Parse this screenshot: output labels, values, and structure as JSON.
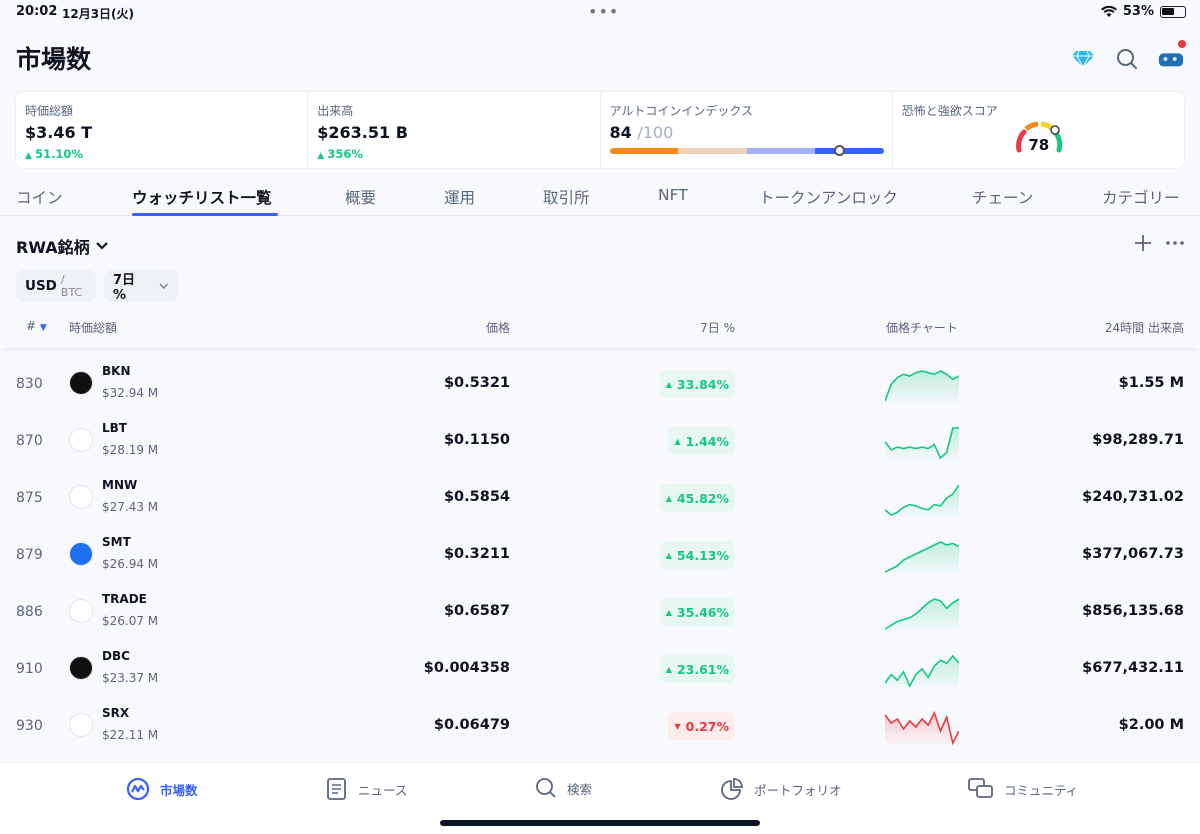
{
  "status_bar": {
    "time": "20:02",
    "date": "12月3日(火)",
    "battery": "53%"
  },
  "header": {
    "title": "市場数"
  },
  "stats": {
    "market_cap": {
      "label": "時価総額",
      "value": "$3.46 T",
      "change": "51.10%"
    },
    "volume": {
      "label": "出来高",
      "value": "$263.51 B",
      "change": "356%"
    },
    "altcoin_index": {
      "label": "アルトコインインデックス",
      "value": "84",
      "max": "/100",
      "level": 0.84
    },
    "fear_greed": {
      "label": "恐怖と強欲スコア",
      "value": "78"
    }
  },
  "tabs": [
    "コイン",
    "ウォッチリスト一覧",
    "概要",
    "運用",
    "取引所",
    "NFT",
    "トークンアンロック",
    "チェーン",
    "カテゴリー"
  ],
  "watchlist": {
    "name": "RWA銘柄",
    "currency_primary": "USD",
    "currency_secondary": "/ BTC",
    "period": "7日 %"
  },
  "table": {
    "headers": {
      "rank": "#",
      "market_cap": "時価総額",
      "price": "価格",
      "change": "7日 %",
      "chart": "価格チャート",
      "volume": "24時間 出来高"
    },
    "rows": [
      {
        "rank": "830",
        "symbol": "BKN",
        "mcap": "$32.94 M",
        "price": "$0.5321",
        "change": "33.84%",
        "trend": "up",
        "volume": "$1.55 M",
        "icon_color": "#111111",
        "spark": [
          12,
          22,
          26,
          28,
          27,
          29,
          30,
          29,
          28,
          30,
          28,
          25,
          27
        ]
      },
      {
        "rank": "870",
        "symbol": "LBT",
        "mcap": "$28.19 M",
        "price": "$0.1150",
        "change": "1.44%",
        "trend": "up",
        "volume": "$98,289.71",
        "icon_color": "#ffffff",
        "spark": [
          20,
          14,
          16,
          15,
          16,
          15,
          16,
          15,
          18,
          8,
          12,
          30,
          30
        ]
      },
      {
        "rank": "875",
        "symbol": "MNW",
        "mcap": "$27.43 M",
        "price": "$0.5854",
        "change": "45.82%",
        "trend": "up",
        "volume": "$240,731.02",
        "icon_color": "#ffffff",
        "spark": [
          8,
          4,
          6,
          10,
          12,
          11,
          9,
          8,
          12,
          11,
          17,
          20,
          27
        ]
      },
      {
        "rank": "879",
        "symbol": "SMT",
        "mcap": "$26.94 M",
        "price": "$0.3211",
        "change": "54.13%",
        "trend": "up",
        "volume": "$377,067.73",
        "icon_color": "#1e6ff0",
        "spark": [
          4,
          6,
          8,
          12,
          14,
          16,
          18,
          20,
          22,
          24,
          22,
          23,
          21
        ]
      },
      {
        "rank": "886",
        "symbol": "TRADE",
        "mcap": "$26.07 M",
        "price": "$0.6587",
        "change": "35.46%",
        "trend": "up",
        "volume": "$856,135.68",
        "icon_color": "#ffffff",
        "spark": [
          6,
          8,
          10,
          11,
          12,
          14,
          17,
          20,
          22,
          21,
          17,
          20,
          22
        ]
      },
      {
        "rank": "910",
        "symbol": "DBC",
        "mcap": "$23.37 M",
        "price": "$0.004358",
        "change": "23.61%",
        "trend": "up",
        "volume": "$677,432.11",
        "icon_color": "#111111",
        "spark": [
          8,
          14,
          10,
          16,
          6,
          14,
          18,
          12,
          20,
          24,
          22,
          27,
          22
        ]
      },
      {
        "rank": "930",
        "symbol": "SRX",
        "mcap": "$22.11 M",
        "price": "$0.06479",
        "change": "0.27%",
        "trend": "down",
        "volume": "$2.00 M",
        "icon_color": "#ffffff",
        "spark": [
          22,
          18,
          20,
          15,
          19,
          16,
          20,
          17,
          23,
          14,
          21,
          8,
          14
        ]
      }
    ]
  },
  "bottom_nav": [
    "市場数",
    "ニュース",
    "検索",
    "ポートフォリオ",
    "コミュニティ"
  ],
  "colors": {
    "accent": "#3861fb",
    "up": "#16c784",
    "down": "#ea3943"
  }
}
